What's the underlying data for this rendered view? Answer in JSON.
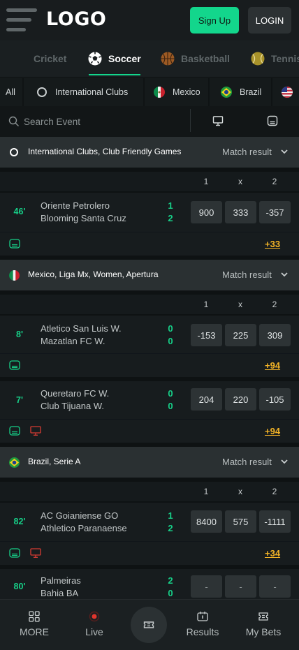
{
  "header": {
    "logo": "LOGO",
    "signup_label": "Sign Up",
    "login_label": "LOGIN"
  },
  "sports_tabs": [
    {
      "label": "Cricket",
      "icon": "cricket-icon",
      "active": false
    },
    {
      "label": "Soccer",
      "icon": "soccer-ball-icon",
      "active": true
    },
    {
      "label": "Basketball",
      "icon": "basketball-icon",
      "active": false
    },
    {
      "label": "Tennis",
      "icon": "tennis-ball-icon",
      "active": false
    }
  ],
  "filters": [
    {
      "label": "All"
    },
    {
      "label": "International Clubs",
      "icon": "globe-icon"
    },
    {
      "label": "Mexico",
      "icon": "mexico-flag-icon"
    },
    {
      "label": "Brazil",
      "icon": "brazil-flag-icon"
    },
    {
      "label": "",
      "icon": "usa-flag-icon"
    }
  ],
  "search": {
    "placeholder": "Search Event",
    "view_icons": [
      "monitor-icon",
      "scoreboard-icon"
    ]
  },
  "col_headers": [
    "1",
    "x",
    "2"
  ],
  "leagues": [
    {
      "name": "International Clubs, Club Friendly Games",
      "market": "Match result",
      "icon": "globe-icon",
      "events": [
        {
          "minute": "46'",
          "home": "Oriente Petrolero",
          "away": "Blooming Santa Cruz",
          "home_score": "1",
          "away_score": "2",
          "odds": [
            "900",
            "333",
            "-357"
          ],
          "more": "+33",
          "icons": [
            "scoreboard-icon"
          ]
        }
      ]
    },
    {
      "name": "Mexico, Liga Mx, Women, Apertura",
      "market": "Match result",
      "icon": "mexico-flag-icon",
      "events": [
        {
          "minute": "8'",
          "home": "Atletico San Luis W.",
          "away": "Mazatlan FC W.",
          "home_score": "0",
          "away_score": "0",
          "odds": [
            "-153",
            "225",
            "309"
          ],
          "more": "+94",
          "icons": [
            "scoreboard-icon"
          ]
        },
        {
          "minute": "7'",
          "home": "Queretaro FC W.",
          "away": "Club Tijuana W.",
          "home_score": "0",
          "away_score": "0",
          "odds": [
            "204",
            "220",
            "-105"
          ],
          "more": "+94",
          "icons": [
            "scoreboard-icon",
            "monitor-icon"
          ]
        }
      ]
    },
    {
      "name": "Brazil, Serie A",
      "market": "Match result",
      "icon": "brazil-flag-icon",
      "events": [
        {
          "minute": "82'",
          "home": "AC Goianiense GO",
          "away": "Athletico Paranaense",
          "home_score": "1",
          "away_score": "2",
          "odds": [
            "8400",
            "575",
            "-1111"
          ],
          "more": "+34",
          "icons": [
            "scoreboard-icon",
            "monitor-icon"
          ]
        },
        {
          "minute": "80'",
          "home": "Palmeiras",
          "away": "Bahia BA",
          "home_score": "2",
          "away_score": "0",
          "odds": [
            "-",
            "-",
            "-"
          ],
          "more": "",
          "icons": []
        }
      ]
    }
  ],
  "bottom_nav": [
    {
      "label": "MORE",
      "icon": "grid-icon"
    },
    {
      "label": "Live",
      "icon": "live-dot-icon"
    },
    {
      "label": "",
      "icon": "ticket-icon"
    },
    {
      "label": "Results",
      "icon": "results-icon"
    },
    {
      "label": "My Bets",
      "icon": "my-bets-icon"
    }
  ],
  "colors": {
    "accent": "#13d68c",
    "odds_more": "#f2b327",
    "live_dot": "#e1352d"
  }
}
